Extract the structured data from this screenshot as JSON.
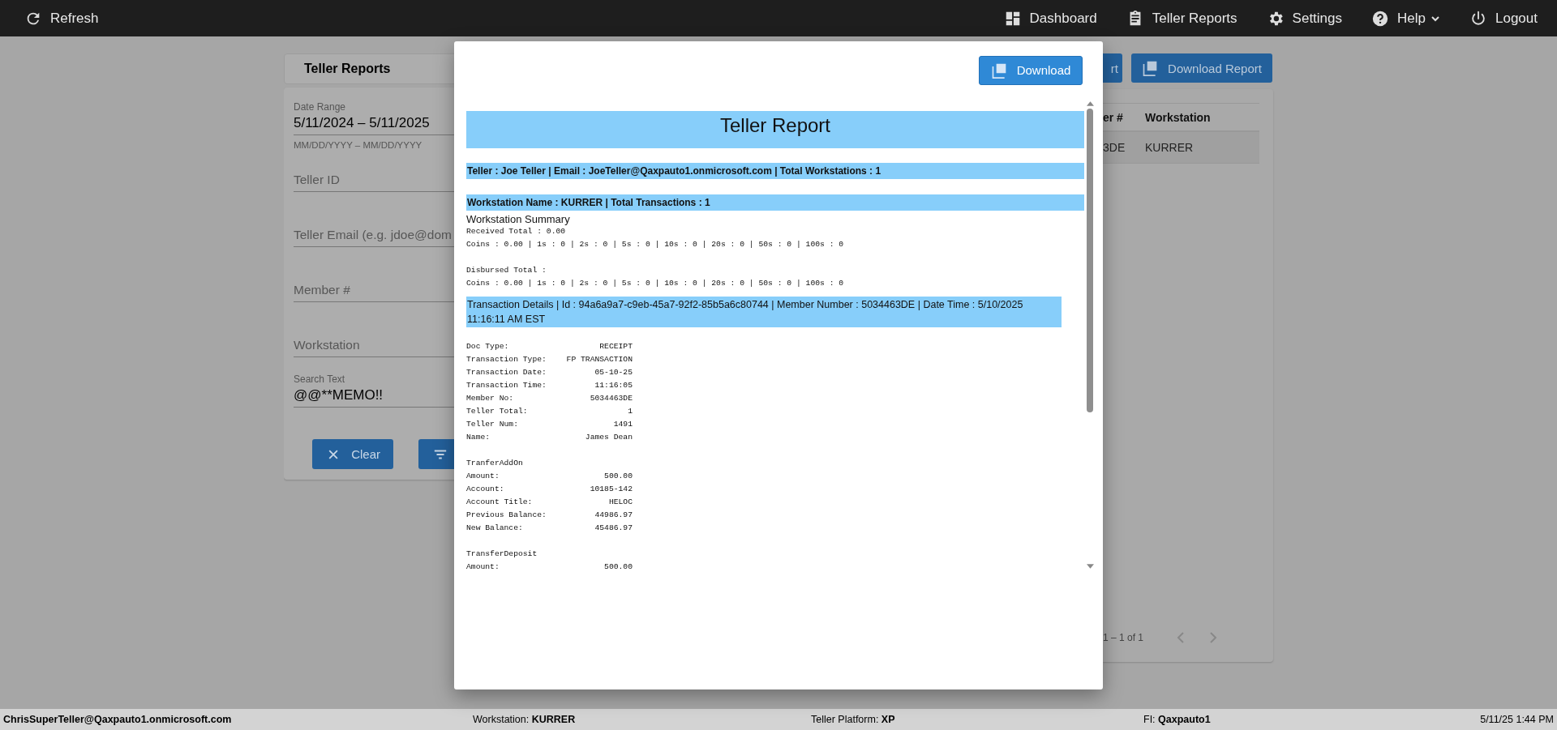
{
  "topbar": {
    "refresh": "Refresh",
    "nav": [
      {
        "label": "Dashboard",
        "menu": false
      },
      {
        "label": "Teller Reports",
        "menu": false
      },
      {
        "label": "Settings",
        "menu": false
      },
      {
        "label": "Help",
        "menu": true
      },
      {
        "label": "Logout",
        "menu": false
      }
    ]
  },
  "panel": {
    "title": "Teller Reports",
    "date_range": {
      "label": "Date Range",
      "value": "5/11/2024 – 5/11/2025",
      "hint": "MM/DD/YYYY – MM/DD/YYYY"
    },
    "fields": [
      {
        "placeholder": "Teller ID"
      },
      {
        "placeholder": "Teller Email (e.g. jdoe@dom"
      },
      {
        "placeholder": "Member #"
      },
      {
        "placeholder": "Workstation"
      },
      {
        "label": "Search Text",
        "value": "@@**MEMO!!"
      }
    ],
    "buttons": [
      {
        "label": "Clear",
        "kind": "clear"
      },
      {
        "kind": "filter"
      }
    ]
  },
  "results": {
    "buttons": [
      {
        "label": "rt",
        "kind": "plain"
      },
      {
        "label": "Download Report",
        "kind": "pdf"
      }
    ],
    "columns": [
      "er #",
      "Workstation"
    ],
    "rows": [
      [
        "3DE",
        "KURRER"
      ]
    ],
    "pagination": "1 – 1 of 1"
  },
  "modal": {
    "download": "Download",
    "report": {
      "title": "Teller Report",
      "teller_band": "Teller : Joe Teller | Email : JoeTeller@Qaxpauto1.onmicrosoft.com | Total Workstations : 1",
      "workstation_band": "Workstation Name : KURRER | Total Transactions : 1",
      "summary_title": "Workstation Summary",
      "summary_groups": [
        {
          "lines": [
            "Received Total : 0.00",
            "Coins : 0.00 | 1s : 0 | 2s : 0 | 5s : 0 | 10s : 0 | 20s : 0 | 50s : 0 | 100s : 0"
          ]
        },
        {
          "lines": [
            "Disbursed Total :",
            "Coins : 0.00 | 1s : 0 | 2s : 0 | 5s : 0 | 10s : 0 | 20s : 0 | 50s : 0 | 100s : 0"
          ]
        }
      ],
      "transaction_band": "Transaction Details | Id : 94a6a9a7-c9eb-45a7-92f2-85b5a6c80744 | Member Number : 5034463DE | Date Time : 5/10/2025 11:16:11 AM EST",
      "receipt_sections": [
        {
          "rows": [
            [
              "Doc Type:",
              "RECEIPT"
            ],
            [
              "Transaction Type:",
              "FP TRANSACTION"
            ],
            [
              "Transaction Date:",
              "05-10-25"
            ],
            [
              "Transaction Time:",
              "11:16:05"
            ],
            [
              "Member No:",
              "5034463DE"
            ],
            [
              "Teller Total:",
              "1"
            ],
            [
              "Teller Num:",
              "1491"
            ],
            [
              "Name:",
              "James Dean"
            ]
          ]
        },
        {
          "heading": "TranferAddOn",
          "rows": [
            [
              "Amount:",
              "500.00"
            ],
            [
              "Account:",
              "10185-142"
            ],
            [
              "Account Title:",
              "HELOC"
            ],
            [
              "Previous Balance:",
              "44986.97"
            ],
            [
              "New Balance:",
              "45486.97"
            ]
          ]
        },
        {
          "heading": "TransferDeposit",
          "rows": [
            [
              "Amount:",
              "500.00"
            ]
          ]
        }
      ]
    }
  },
  "status_bar": {
    "user": "ChrisSuperTeller@Qaxpauto1.onmicrosoft.com",
    "items": [
      "Workstation: **KURRER**",
      "Teller Platform: **XP**",
      "FI: **Qaxpauto1**"
    ],
    "datetime": "5/11/25 1:44 PM"
  }
}
